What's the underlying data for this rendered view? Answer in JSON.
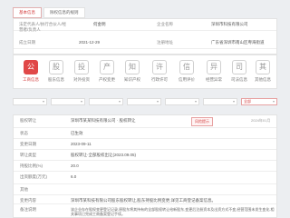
{
  "tabs": [
    "基本信息",
    "除权信息的规则"
  ],
  "basic": {
    "legal_rep_label": "法定代表人/执行合伙人/经营者/负责人",
    "legal_rep_value": "何金明",
    "company_name_label": "企业名称",
    "company_name_value": "深圳市科技有限公司",
    "reg_date_label": "成立日期",
    "reg_date_value": "2021-12-29",
    "address_label": "注册地址",
    "address_value": "广东省深圳市南山区粤海街道"
  },
  "nav": [
    {
      "label": "工商信息",
      "icon": "公",
      "active": true
    },
    {
      "label": "股东信息",
      "icon": "股",
      "active": false
    },
    {
      "label": "对外投资",
      "icon": "投",
      "active": false
    },
    {
      "label": "产权变更",
      "icon": "产",
      "active": false
    },
    {
      "label": "知识产权",
      "icon": "知",
      "active": false
    },
    {
      "label": "行政许可",
      "icon": "许",
      "active": false
    },
    {
      "label": "信用评价",
      "icon": "信",
      "active": false
    },
    {
      "label": "经营异常",
      "icon": "异",
      "active": false
    },
    {
      "label": "司法信息",
      "icon": "司",
      "active": false
    },
    {
      "label": "其他信息",
      "icon": "其",
      "active": false
    }
  ],
  "filters": {
    "f1": "",
    "f2": "",
    "f3": "",
    "f4": "",
    "f5": "",
    "f6": "",
    "f7": "全部",
    "f8": ""
  },
  "detail": {
    "name_label": "股权转让",
    "name_value": "深圳市某某科技有限公司 · 股权转让",
    "badge": "风险提示",
    "date_right": "2024年01月",
    "status_label": "状态",
    "status_value": "已生效",
    "date_label": "变更日期",
    "date_value": "2023-09-11",
    "type_label": "转让类型",
    "type_value": "股权转让·全部股权出让(2023.09.05)",
    "ratio_label": "持股比例(%)",
    "ratio_value": "20.0",
    "amount_label": "出资额度(万元)",
    "amount_value": "6.0",
    "other_label": "其他",
    "other_value": "",
    "desc_label": "变更内容",
    "desc_value": "深圳市某科技有限公司股东股权转让,股东持股比例变更,详见工商登记备案信息。",
    "note_label": "备注说明",
    "note_value": "该企业存在股权变更登记记录,原股东将其持有的全部股权转让给新股东,变更后注册资本及出资方式不变,经营范围未发生变化,相关事项已完成工商备案登记手续。"
  }
}
